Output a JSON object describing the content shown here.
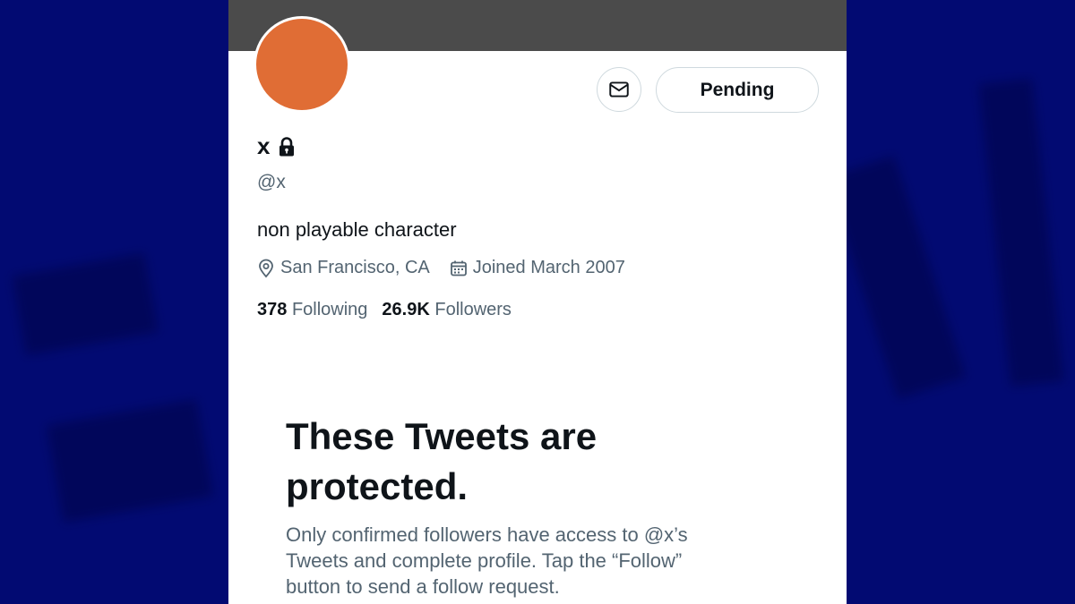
{
  "profile": {
    "name": "x",
    "handle": "@x",
    "bio": "non playable character",
    "location": "San Francisco, CA",
    "joined": "Joined March 2007",
    "following_count": "378",
    "following_label": "Following",
    "followers_count": "26.9K",
    "followers_label": "Followers",
    "avatar_color": "#e06d35",
    "protected_icon": "lock-icon"
  },
  "actions": {
    "message_icon": "mail-icon",
    "follow_status_label": "Pending"
  },
  "protected_notice": {
    "title": "These Tweets are protected.",
    "body": "Only confirmed followers have access to @x’s Tweets and complete profile. Tap the “Follow” button to send a follow request."
  },
  "colors": {
    "background": "#020a72",
    "banner": "#4b4b4b",
    "text_primary": "#0f1419",
    "text_secondary": "#536471",
    "border": "#cfd9de"
  }
}
